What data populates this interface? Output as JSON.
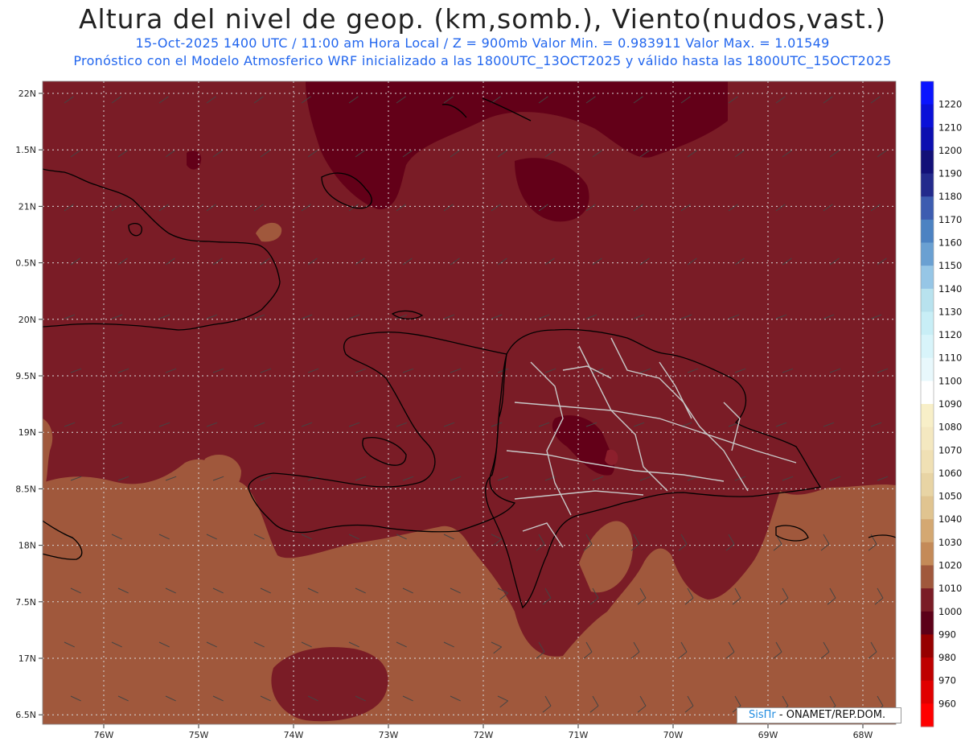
{
  "header": {
    "title": "Altura del nivel de geop. (km,somb.), Viento(nudos,vast.)",
    "line1": "15-Oct-2025  1400 UTC / 11:00 am Hora Local / Z = 900mb   Valor Min. = 0.983911  Valor Max. = 1.01549",
    "line2": "Pronóstico con el Modelo Atmosferico WRF inicializado a las 1800UTC_13OCT2025 y válido hasta las  1800UTC_15OCT2025"
  },
  "lat_ticks": [
    "22N",
    "1.5N",
    "21N",
    "0.5N",
    "20N",
    "9.5N",
    "19N",
    "8.5N",
    "18N",
    "7.5N",
    "17N",
    "6.5N"
  ],
  "lon_ticks": [
    "76W",
    "75W",
    "74W",
    "73W",
    "72W",
    "71W",
    "70W",
    "69W",
    "68W"
  ],
  "colorbar": {
    "labels": [
      "1220",
      "1210",
      "1200",
      "1190",
      "1180",
      "1170",
      "1160",
      "1150",
      "1140",
      "1130",
      "1120",
      "1110",
      "1100",
      "1090",
      "1080",
      "1070",
      "1060",
      "1050",
      "1040",
      "1030",
      "1020",
      "1010",
      "1000",
      "990",
      "980",
      "970",
      "960"
    ],
    "colors": [
      "#0a14ff",
      "#0a10d8",
      "#0c0eb0",
      "#121078",
      "#232a8c",
      "#3d5cb0",
      "#4c82c2",
      "#6aa0d2",
      "#96c6e6",
      "#b8e2ee",
      "#c8eef6",
      "#d8f4fa",
      "#e8f8fc",
      "#ffffff",
      "#f8efc8",
      "#f4e8c0",
      "#f0e0b4",
      "#e8d4a4",
      "#e0c490",
      "#d4a872",
      "#c48a58",
      "#a0583c",
      "#7a1c26",
      "#5c0018",
      "#960000",
      "#be0000",
      "#e00000",
      "#ff0000"
    ]
  },
  "colors": {
    "land_ocean_high": "#7a1c26",
    "dark_low": "#630018",
    "south_band": "#a0583c",
    "coastline": "#000000",
    "provinces": "#c8c8c8"
  },
  "credit": {
    "brand": "SisПr",
    "text": " - ONAMET/REP.DOM."
  }
}
